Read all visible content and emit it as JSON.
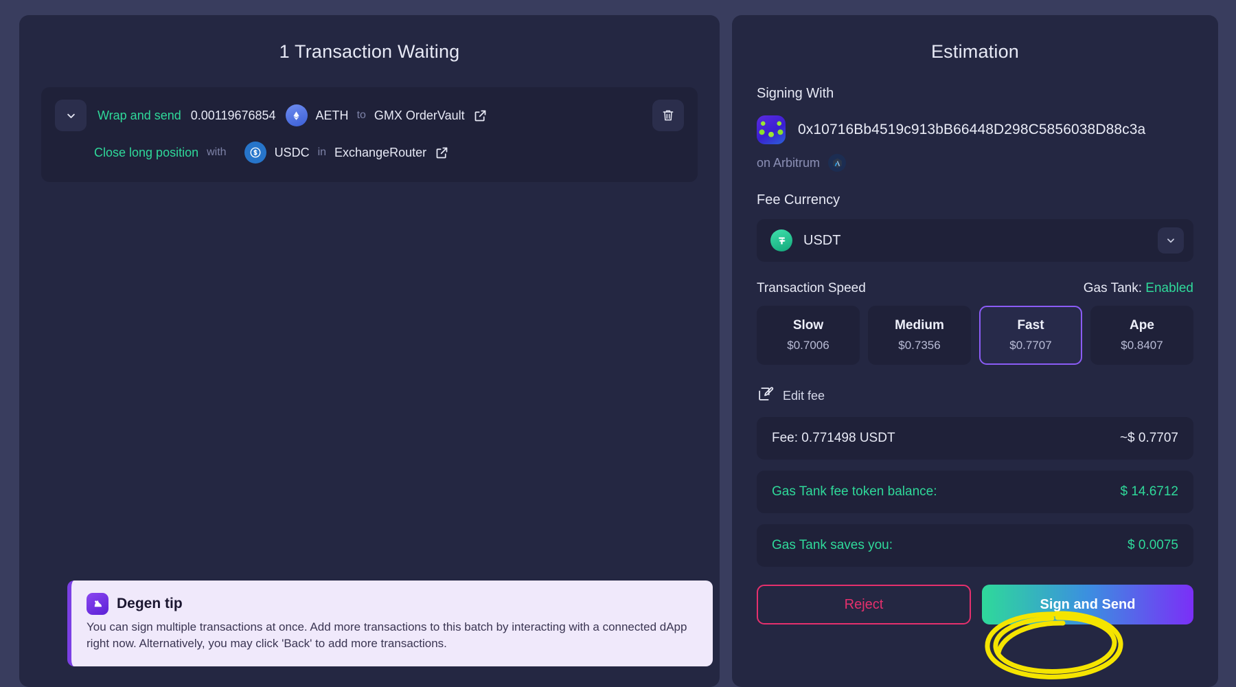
{
  "theme": {
    "background": "#393d5e",
    "panel": "#242742",
    "card": "#1f2139",
    "accent_green": "#2fd99a",
    "accent_purple": "#8b5cf6",
    "reject_pink": "#e6306d",
    "annotation_yellow": "#f5e400"
  },
  "left_panel": {
    "title": "1 Transaction Waiting",
    "transaction": {
      "expand_icon": "chevron-down-icon",
      "delete_icon": "trash-icon",
      "rows": [
        {
          "action": "Wrap and send",
          "amount": "0.00119676854",
          "token_icon": "eth-icon",
          "token": "AETH",
          "preposition": "to",
          "destination": "GMX OrderVault",
          "link_icon": "external-link-icon"
        },
        {
          "action": "Close long position",
          "preposition_before": "with",
          "token_icon": "usdc-icon",
          "token": "USDC",
          "preposition": "in",
          "destination": "ExchangeRouter",
          "link_icon": "external-link-icon"
        }
      ]
    },
    "tip": {
      "logo_icon": "degen-ape-icon",
      "title": "Degen tip",
      "body": "You can sign multiple transactions at once. Add more transactions to this batch by interacting with a connected dApp right now. Alternatively, you may click 'Back' to add more transactions."
    }
  },
  "right_panel": {
    "title": "Estimation",
    "signing": {
      "label": "Signing With",
      "avatar_icon": "identicon-avatar",
      "address": "0x10716Bb4519c913bB66448D298C5856038D88c3a",
      "chain_label": "on Arbitrum",
      "chain_icon": "arbitrum-icon"
    },
    "fee_currency": {
      "label": "Fee Currency",
      "token_icon": "usdt-icon",
      "selected": "USDT",
      "caret_icon": "chevron-down-icon"
    },
    "speed": {
      "label": "Transaction Speed",
      "gas_tank_label": "Gas Tank:",
      "gas_tank_status": "Enabled",
      "options": [
        {
          "name": "Slow",
          "price": "$0.7006",
          "selected": false
        },
        {
          "name": "Medium",
          "price": "$0.7356",
          "selected": false
        },
        {
          "name": "Fast",
          "price": "$0.7707",
          "selected": true
        },
        {
          "name": "Ape",
          "price": "$0.8407",
          "selected": false
        }
      ]
    },
    "edit_fee": {
      "icon": "edit-pencil-icon",
      "label": "Edit fee"
    },
    "summary_rows": [
      {
        "left": "Fee: 0.771498 USDT",
        "right": "~$ 0.7707",
        "green": false
      },
      {
        "left": "Gas Tank fee token balance:",
        "right": "$ 14.6712",
        "green": true
      },
      {
        "left": "Gas Tank saves you:",
        "right": "$ 0.0075",
        "green": true
      }
    ],
    "actions": {
      "reject_label": "Reject",
      "sign_label": "Sign and Send"
    }
  }
}
